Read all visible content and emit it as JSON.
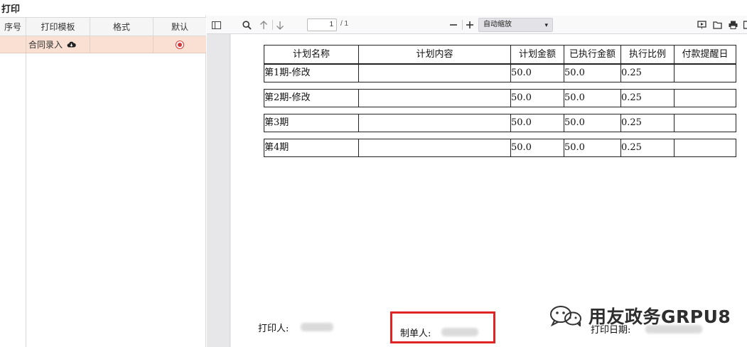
{
  "window": {
    "title": "打印"
  },
  "template_grid": {
    "columns": [
      "序号",
      "打印模板",
      "格式",
      "默认"
    ],
    "rows": [
      {
        "seq": "",
        "template": "合同录入",
        "template_icon": "cloud-download-icon",
        "format": "",
        "default_selected": true
      }
    ]
  },
  "viewer_toolbar": {
    "page_current": "1",
    "page_total": "/ 1",
    "zoom_value": "自动缩放",
    "zoom_caret": "▾"
  },
  "document": {
    "table_headers": [
      "计划名称",
      "计划内容",
      "计划金额",
      "已执行金额",
      "执行比例",
      "付款提醒日"
    ],
    "rows": [
      [
        "第1期-修改",
        "",
        "50.0",
        "50.0",
        "0.25",
        ""
      ],
      [
        "第2期-修改",
        "",
        "50.0",
        "50.0",
        "0.25",
        ""
      ],
      [
        "第3期",
        "",
        "50.0",
        "50.0",
        "0.25",
        ""
      ],
      [
        "第4期",
        "",
        "50.0",
        "50.0",
        "0.25",
        ""
      ]
    ],
    "printer_label": "打印人:",
    "creator_label": "制单人:",
    "print_date_label": "打印日期:"
  },
  "watermark": {
    "text": "用友政务GRPU8"
  },
  "colors": {
    "selected_row": "#f9e0d3",
    "radio_accent": "#d23b3b",
    "highlight_border": "#e02424"
  }
}
